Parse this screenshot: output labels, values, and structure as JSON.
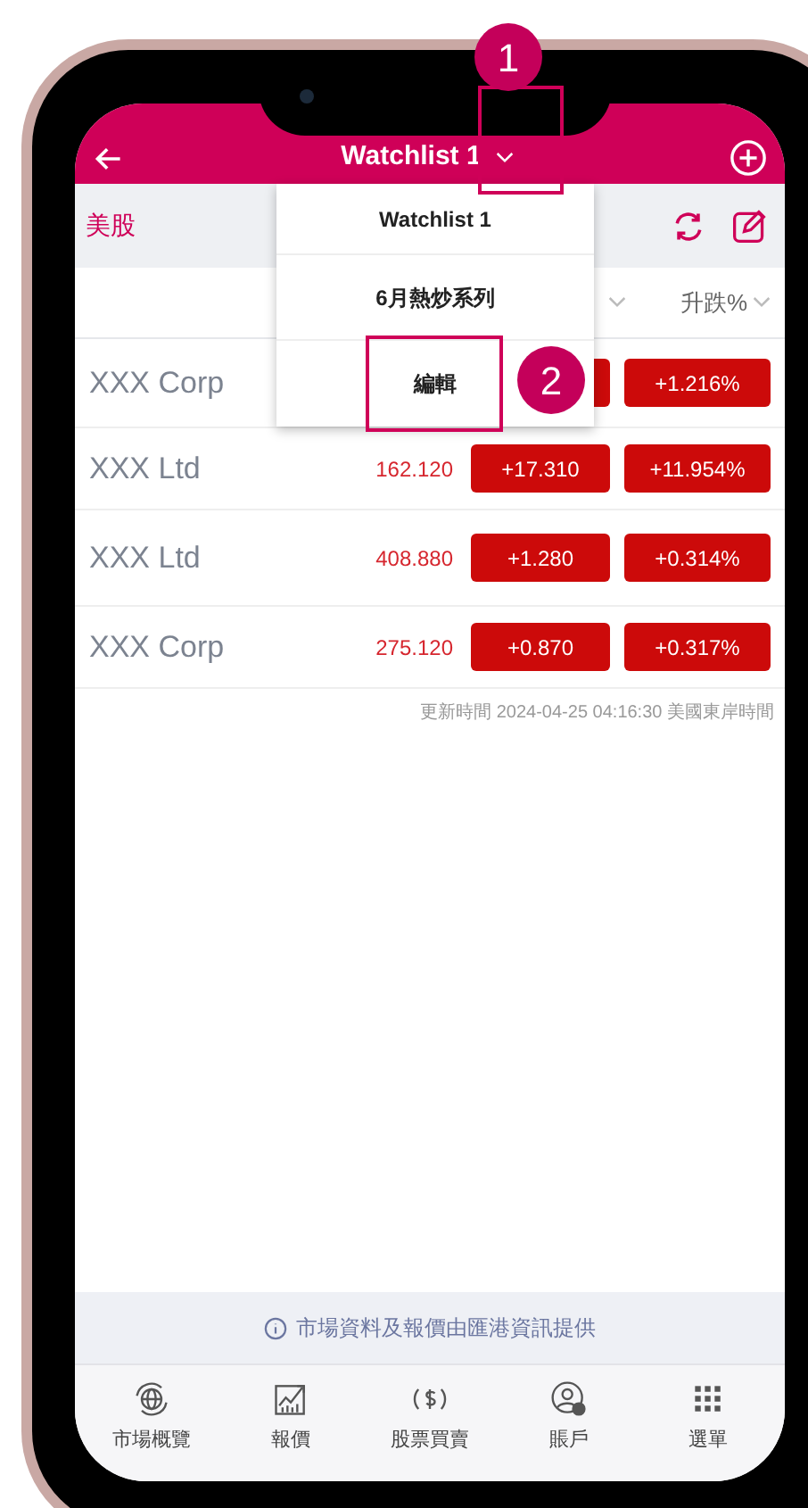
{
  "header": {
    "title": "Watchlist 1"
  },
  "market_tab": "美股",
  "column_header": {
    "label": "升跌%"
  },
  "dropdown": {
    "items": [
      {
        "label": "Watchlist 1"
      },
      {
        "label": "6月熱炒系列"
      },
      {
        "label": "編輯"
      }
    ]
  },
  "rows": [
    {
      "name": "XXX Corp",
      "change_pct": "+1.216%"
    },
    {
      "name": "XXX Ltd",
      "price": "162.120",
      "change": "+17.310",
      "change_pct": "+11.954%"
    },
    {
      "name": "XXX Ltd",
      "price": "408.880",
      "change": "+1.280",
      "change_pct": "+0.314%"
    },
    {
      "name": "XXX Corp",
      "price": "275.120",
      "change": "+0.870",
      "change_pct": "+0.317%"
    }
  ],
  "updated": "更新時間 2024-04-25 04:16:30 美國東岸時間",
  "notice": "市場資料及報價由匯港資訊提供",
  "nav": [
    {
      "kind": "globe",
      "label": "市場概覽"
    },
    {
      "kind": "chart",
      "label": "報價"
    },
    {
      "kind": "dollar",
      "label": "股票買賣"
    },
    {
      "kind": "account",
      "label": "賬戶"
    },
    {
      "kind": "grid",
      "label": "選單"
    }
  ],
  "callouts": [
    {
      "number": "1"
    },
    {
      "number": "2"
    }
  ]
}
